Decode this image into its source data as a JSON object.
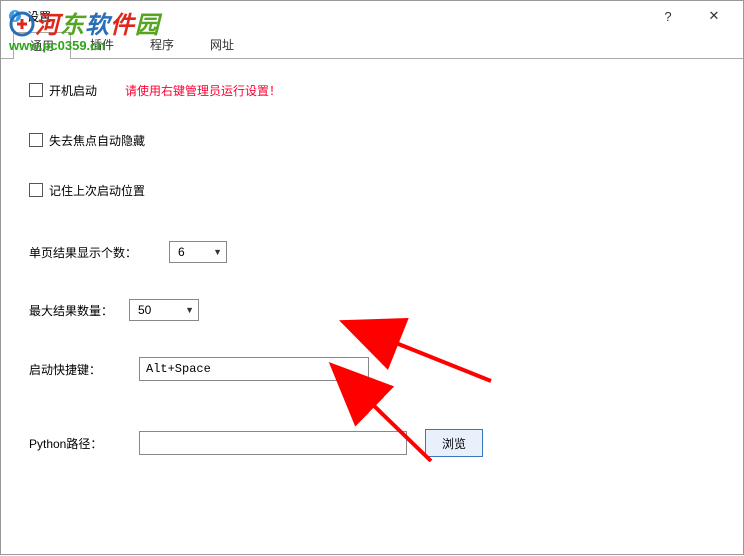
{
  "title": "设置",
  "title_btns": {
    "help": "?",
    "close": "✕"
  },
  "tabs": [
    "通用",
    "插件",
    "程序",
    "网址"
  ],
  "active_tab_index": 0,
  "chk": {
    "startup": "开机启动",
    "startup_warn": "请使用右键管理员运行设置！",
    "autohide": "失去焦点自动隐藏",
    "remember_pos": "记住上次启动位置"
  },
  "labels": {
    "page_results": "单页结果显示个数：",
    "max_results": "最大结果数量：",
    "hotkey": "启动快捷键：",
    "python_path": "Python路径："
  },
  "values": {
    "page_results": "6",
    "max_results": "50",
    "hotkey": "Alt+Space",
    "python_path": ""
  },
  "browse_btn": "浏览",
  "watermark": {
    "line1": "河东软件园",
    "line2": "www.pc0359.cn"
  }
}
